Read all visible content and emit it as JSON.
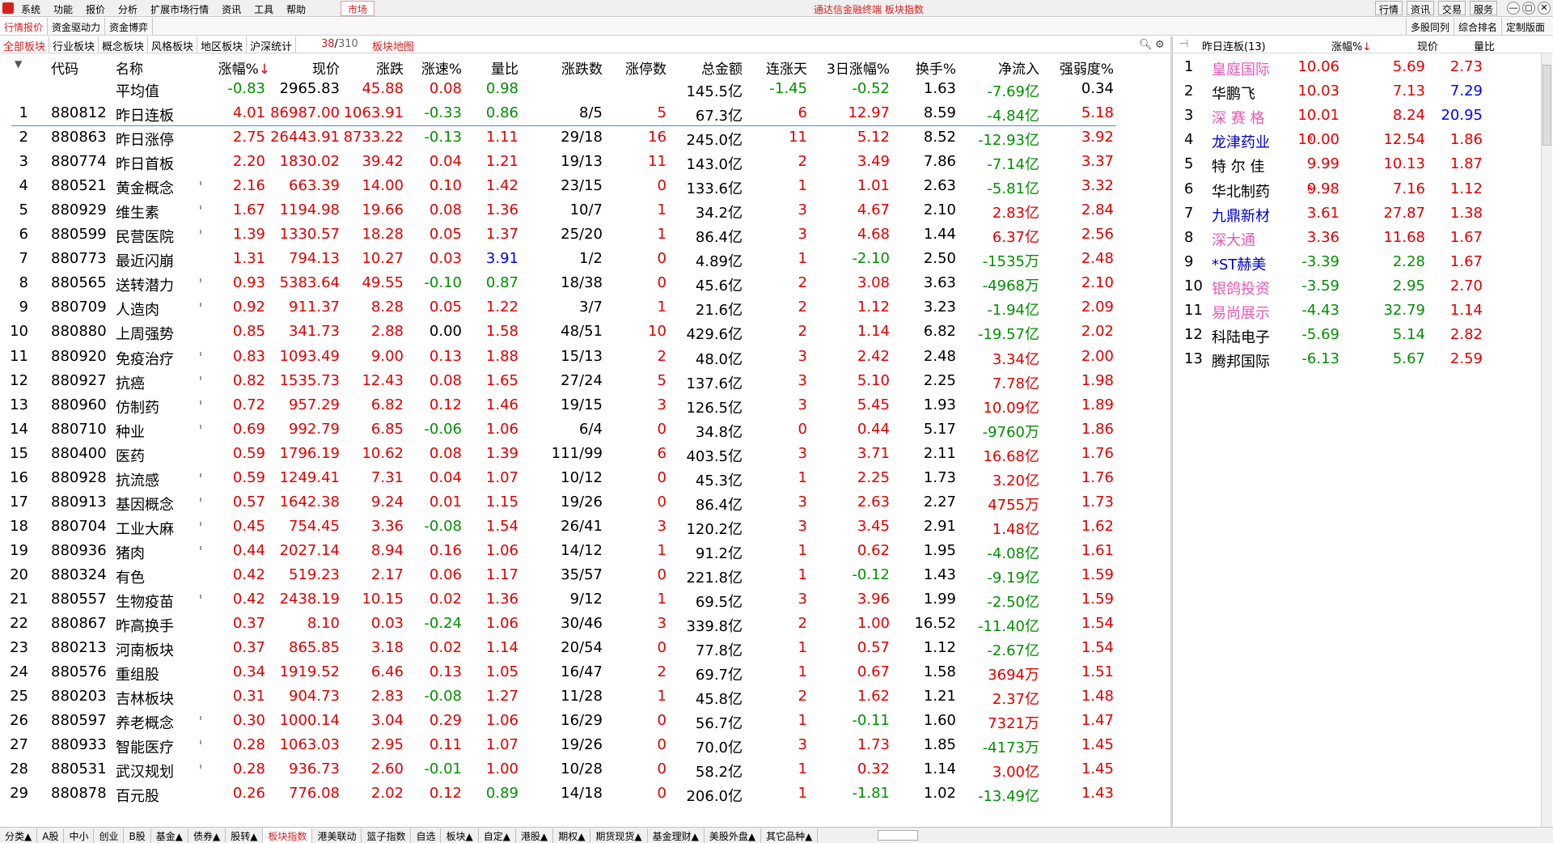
{
  "menubar": {
    "items": [
      "系统",
      "功能",
      "报价",
      "分析",
      "扩展市场行情",
      "资讯",
      "工具",
      "帮助"
    ],
    "market_label": "市场",
    "title": "通达信金融终端  板块指数",
    "right_buttons": [
      "行情",
      "资讯",
      "交易",
      "服务"
    ],
    "window_buttons": [
      "—",
      "◻",
      "✕"
    ]
  },
  "bar2": {
    "tabs": [
      "行情报价",
      "资金驱动力",
      "资金博弈"
    ],
    "right_tabs": [
      "多股同列",
      "综合排名",
      "定制版面"
    ]
  },
  "bar3": {
    "tabs": [
      "全部板块",
      "行业板块",
      "概念板块",
      "风格板块",
      "地区板块",
      "沪深统计"
    ],
    "pager_current": "38",
    "pager_sep": "/",
    "pager_total": "310",
    "map_label": "板块地图"
  },
  "table": {
    "headers": [
      "代码",
      "名称",
      "涨幅%",
      "现价",
      "涨跌",
      "涨速%",
      "量比",
      "涨跌数",
      "涨停数",
      "总金额",
      "连涨天",
      "3日涨幅%",
      "换手%",
      "净流入",
      "强弱度%"
    ],
    "sort_arrow": "↓",
    "average": {
      "label": "平均值",
      "change_pct": "-0.83",
      "price": "2965.83",
      "change": "45.88",
      "speed": "0.08",
      "vol_ratio": "0.98",
      "amount": "145.5亿",
      "up_days": "-1.45",
      "chg3": "-0.52",
      "turnover": "1.63",
      "net_inflow": "-7.69亿",
      "strength": "0.34"
    },
    "rows": [
      {
        "no": "1",
        "code": "880812",
        "name": "昨日连板",
        "pct": "4.01",
        "price": "86987.00",
        "chg": "1063.91",
        "spd": "-0.33",
        "vr": "0.86",
        "ud": "8/5",
        "lim": "5",
        "amt": "67.3亿",
        "days": "6",
        "c3": "12.97",
        "to": "8.59",
        "net": "-4.84亿",
        "str": "5.18",
        "tick": false
      },
      {
        "no": "2",
        "code": "880863",
        "name": "昨日涨停",
        "pct": "2.75",
        "price": "26443.91",
        "chg": "8733.22",
        "spd": "-0.13",
        "vr": "1.11",
        "ud": "29/18",
        "lim": "16",
        "amt": "245.0亿",
        "days": "11",
        "c3": "5.12",
        "to": "8.52",
        "net": "-12.93亿",
        "str": "3.92",
        "tick": false
      },
      {
        "no": "3",
        "code": "880774",
        "name": "昨日首板",
        "pct": "2.20",
        "price": "1830.02",
        "chg": "39.42",
        "spd": "0.04",
        "vr": "1.21",
        "ud": "19/13",
        "lim": "11",
        "amt": "143.0亿",
        "days": "2",
        "c3": "3.49",
        "to": "7.86",
        "net": "-7.14亿",
        "str": "3.37",
        "tick": false
      },
      {
        "no": "4",
        "code": "880521",
        "name": "黄金概念",
        "pct": "2.16",
        "price": "663.39",
        "chg": "14.00",
        "spd": "0.10",
        "vr": "1.42",
        "ud": "23/15",
        "lim": "0",
        "amt": "133.6亿",
        "days": "1",
        "c3": "1.01",
        "to": "2.63",
        "net": "-5.81亿",
        "str": "3.32",
        "tick": true
      },
      {
        "no": "5",
        "code": "880929",
        "name": "维生素",
        "pct": "1.67",
        "price": "1194.98",
        "chg": "19.66",
        "spd": "0.08",
        "vr": "1.36",
        "ud": "10/7",
        "lim": "1",
        "amt": "34.2亿",
        "days": "3",
        "c3": "4.67",
        "to": "2.10",
        "net": "2.83亿",
        "str": "2.84",
        "tick": true
      },
      {
        "no": "6",
        "code": "880599",
        "name": "民营医院",
        "pct": "1.39",
        "price": "1330.57",
        "chg": "18.28",
        "spd": "0.05",
        "vr": "1.37",
        "ud": "25/20",
        "lim": "1",
        "amt": "86.4亿",
        "days": "3",
        "c3": "4.68",
        "to": "1.44",
        "net": "6.37亿",
        "str": "2.56",
        "tick": true
      },
      {
        "no": "7",
        "code": "880773",
        "name": "最近闪崩",
        "pct": "1.31",
        "price": "794.13",
        "chg": "10.27",
        "spd": "0.03",
        "vr": "3.91",
        "ud": "1/2",
        "lim": "0",
        "amt": "4.89亿",
        "days": "1",
        "c3": "-2.10",
        "to": "2.50",
        "net": "-1535万",
        "str": "2.48",
        "tick": false
      },
      {
        "no": "8",
        "code": "880565",
        "name": "送转潜力",
        "pct": "0.93",
        "price": "5383.64",
        "chg": "49.55",
        "spd": "-0.10",
        "vr": "0.87",
        "ud": "18/38",
        "lim": "0",
        "amt": "45.6亿",
        "days": "2",
        "c3": "3.08",
        "to": "3.63",
        "net": "-4968万",
        "str": "2.10",
        "tick": true
      },
      {
        "no": "9",
        "code": "880709",
        "name": "人造肉",
        "pct": "0.92",
        "price": "911.37",
        "chg": "8.28",
        "spd": "0.05",
        "vr": "1.22",
        "ud": "3/7",
        "lim": "1",
        "amt": "21.6亿",
        "days": "2",
        "c3": "1.12",
        "to": "3.23",
        "net": "-1.94亿",
        "str": "2.09",
        "tick": true
      },
      {
        "no": "10",
        "code": "880880",
        "name": "上周强势",
        "pct": "0.85",
        "price": "341.73",
        "chg": "2.88",
        "spd": "0.00",
        "vr": "1.58",
        "ud": "48/51",
        "lim": "10",
        "amt": "429.6亿",
        "days": "2",
        "c3": "1.14",
        "to": "6.82",
        "net": "-19.57亿",
        "str": "2.02",
        "tick": false
      },
      {
        "no": "11",
        "code": "880920",
        "name": "免疫治疗",
        "pct": "0.83",
        "price": "1093.49",
        "chg": "9.00",
        "spd": "0.13",
        "vr": "1.88",
        "ud": "15/13",
        "lim": "2",
        "amt": "48.0亿",
        "days": "3",
        "c3": "2.42",
        "to": "2.48",
        "net": "3.34亿",
        "str": "2.00",
        "tick": true
      },
      {
        "no": "12",
        "code": "880927",
        "name": "抗癌",
        "pct": "0.82",
        "price": "1535.73",
        "chg": "12.43",
        "spd": "0.08",
        "vr": "1.65",
        "ud": "27/24",
        "lim": "5",
        "amt": "137.6亿",
        "days": "3",
        "c3": "5.10",
        "to": "2.25",
        "net": "7.78亿",
        "str": "1.98",
        "tick": true
      },
      {
        "no": "13",
        "code": "880960",
        "name": "仿制药",
        "pct": "0.72",
        "price": "957.29",
        "chg": "6.82",
        "spd": "0.12",
        "vr": "1.46",
        "ud": "19/15",
        "lim": "3",
        "amt": "126.5亿",
        "days": "3",
        "c3": "5.45",
        "to": "1.93",
        "net": "10.09亿",
        "str": "1.89",
        "tick": true
      },
      {
        "no": "14",
        "code": "880710",
        "name": "种业",
        "pct": "0.69",
        "price": "992.79",
        "chg": "6.85",
        "spd": "-0.06",
        "vr": "1.06",
        "ud": "6/4",
        "lim": "0",
        "amt": "34.8亿",
        "days": "0",
        "c3": "0.44",
        "to": "5.17",
        "net": "-9760万",
        "str": "1.86",
        "tick": true
      },
      {
        "no": "15",
        "code": "880400",
        "name": "医药",
        "pct": "0.59",
        "price": "1796.19",
        "chg": "10.62",
        "spd": "0.08",
        "vr": "1.39",
        "ud": "111/99",
        "lim": "6",
        "amt": "403.5亿",
        "days": "3",
        "c3": "3.71",
        "to": "2.11",
        "net": "16.68亿",
        "str": "1.76",
        "tick": false
      },
      {
        "no": "16",
        "code": "880928",
        "name": "抗流感",
        "pct": "0.59",
        "price": "1249.41",
        "chg": "7.31",
        "spd": "0.04",
        "vr": "1.07",
        "ud": "10/12",
        "lim": "0",
        "amt": "45.3亿",
        "days": "1",
        "c3": "2.25",
        "to": "1.73",
        "net": "3.20亿",
        "str": "1.76",
        "tick": true
      },
      {
        "no": "17",
        "code": "880913",
        "name": "基因概念",
        "pct": "0.57",
        "price": "1642.38",
        "chg": "9.24",
        "spd": "0.01",
        "vr": "1.15",
        "ud": "19/26",
        "lim": "0",
        "amt": "86.4亿",
        "days": "3",
        "c3": "2.63",
        "to": "2.27",
        "net": "4755万",
        "str": "1.73",
        "tick": true
      },
      {
        "no": "18",
        "code": "880704",
        "name": "工业大麻",
        "pct": "0.45",
        "price": "754.45",
        "chg": "3.36",
        "spd": "-0.08",
        "vr": "1.54",
        "ud": "26/41",
        "lim": "3",
        "amt": "120.2亿",
        "days": "3",
        "c3": "3.45",
        "to": "2.91",
        "net": "1.48亿",
        "str": "1.62",
        "tick": true
      },
      {
        "no": "19",
        "code": "880936",
        "name": "猪肉",
        "pct": "0.44",
        "price": "2027.14",
        "chg": "8.94",
        "spd": "0.16",
        "vr": "1.06",
        "ud": "14/12",
        "lim": "1",
        "amt": "91.2亿",
        "days": "1",
        "c3": "0.62",
        "to": "1.95",
        "net": "-4.08亿",
        "str": "1.61",
        "tick": true
      },
      {
        "no": "20",
        "code": "880324",
        "name": "有色",
        "pct": "0.42",
        "price": "519.23",
        "chg": "2.17",
        "spd": "0.06",
        "vr": "1.17",
        "ud": "35/57",
        "lim": "0",
        "amt": "221.8亿",
        "days": "1",
        "c3": "-0.12",
        "to": "1.43",
        "net": "-9.19亿",
        "str": "1.59",
        "tick": false
      },
      {
        "no": "21",
        "code": "880557",
        "name": "生物疫苗",
        "pct": "0.42",
        "price": "2438.19",
        "chg": "10.15",
        "spd": "0.02",
        "vr": "1.36",
        "ud": "9/12",
        "lim": "1",
        "amt": "69.5亿",
        "days": "3",
        "c3": "3.96",
        "to": "1.99",
        "net": "-2.50亿",
        "str": "1.59",
        "tick": true
      },
      {
        "no": "22",
        "code": "880867",
        "name": "昨高换手",
        "pct": "0.37",
        "price": "8.10",
        "chg": "0.03",
        "spd": "-0.24",
        "vr": "1.06",
        "ud": "30/46",
        "lim": "3",
        "amt": "339.8亿",
        "days": "2",
        "c3": "1.00",
        "to": "16.52",
        "net": "-11.40亿",
        "str": "1.54",
        "tick": false
      },
      {
        "no": "23",
        "code": "880213",
        "name": "河南板块",
        "pct": "0.37",
        "price": "865.85",
        "chg": "3.18",
        "spd": "0.02",
        "vr": "1.14",
        "ud": "20/54",
        "lim": "0",
        "amt": "77.8亿",
        "days": "1",
        "c3": "0.57",
        "to": "1.12",
        "net": "-2.67亿",
        "str": "1.54",
        "tick": false
      },
      {
        "no": "24",
        "code": "880576",
        "name": "重组股",
        "pct": "0.34",
        "price": "1919.52",
        "chg": "6.46",
        "spd": "0.13",
        "vr": "1.05",
        "ud": "16/47",
        "lim": "2",
        "amt": "69.7亿",
        "days": "1",
        "c3": "0.67",
        "to": "1.58",
        "net": "3694万",
        "str": "1.51",
        "tick": false
      },
      {
        "no": "25",
        "code": "880203",
        "name": "吉林板块",
        "pct": "0.31",
        "price": "904.73",
        "chg": "2.83",
        "spd": "-0.08",
        "vr": "1.27",
        "ud": "11/28",
        "lim": "1",
        "amt": "45.8亿",
        "days": "2",
        "c3": "1.62",
        "to": "1.21",
        "net": "2.37亿",
        "str": "1.48",
        "tick": false
      },
      {
        "no": "26",
        "code": "880597",
        "name": "养老概念",
        "pct": "0.30",
        "price": "1000.14",
        "chg": "3.04",
        "spd": "0.29",
        "vr": "1.06",
        "ud": "16/29",
        "lim": "0",
        "amt": "56.7亿",
        "days": "1",
        "c3": "-0.11",
        "to": "1.60",
        "net": "7321万",
        "str": "1.47",
        "tick": true
      },
      {
        "no": "27",
        "code": "880933",
        "name": "智能医疗",
        "pct": "0.28",
        "price": "1063.03",
        "chg": "2.95",
        "spd": "0.11",
        "vr": "1.07",
        "ud": "19/26",
        "lim": "0",
        "amt": "70.0亿",
        "days": "3",
        "c3": "1.73",
        "to": "1.85",
        "net": "-4173万",
        "str": "1.45",
        "tick": true
      },
      {
        "no": "28",
        "code": "880531",
        "name": "武汉规划",
        "pct": "0.28",
        "price": "936.73",
        "chg": "2.60",
        "spd": "-0.01",
        "vr": "1.00",
        "ud": "10/28",
        "lim": "0",
        "amt": "58.2亿",
        "days": "1",
        "c3": "0.32",
        "to": "1.14",
        "net": "3.00亿",
        "str": "1.45",
        "tick": true
      },
      {
        "no": "29",
        "code": "880878",
        "name": "百元股",
        "pct": "0.26",
        "price": "776.08",
        "chg": "2.02",
        "spd": "0.12",
        "vr": "0.89",
        "ud": "14/18",
        "lim": "0",
        "amt": "206.0亿",
        "days": "1",
        "c3": "-1.81",
        "to": "1.02",
        "net": "-13.49亿",
        "str": "1.43",
        "tick": false
      }
    ]
  },
  "right_panel": {
    "pin_icon": "⊣",
    "title": "昨日连板(13)",
    "col_pct": "涨幅%",
    "col_price": "现价",
    "col_vr": "量比",
    "sort_arrow": "↓",
    "rows": [
      {
        "no": "1",
        "name": "皇庭国际",
        "tag": "",
        "pct": "10.06",
        "price": "5.69",
        "vr": "2.73",
        "color": "#e85ab4",
        "vrblue": false
      },
      {
        "no": "2",
        "name": "华鹏飞",
        "tag": "",
        "pct": "10.03",
        "price": "7.13",
        "vr": "7.29",
        "color": "#000000",
        "vrblue": true
      },
      {
        "no": "3",
        "name": "深 赛 格",
        "tag": "",
        "pct": "10.01",
        "price": "8.24",
        "vr": "20.95",
        "color": "#e85ab4",
        "vrblue": true
      },
      {
        "no": "4",
        "name": "龙津药业",
        "tag": "R",
        "pct": "10.00",
        "price": "12.54",
        "vr": "1.86",
        "color": "#0000cc",
        "vrblue": false
      },
      {
        "no": "5",
        "name": "特 尔 佳",
        "tag": "",
        "pct": "9.99",
        "price": "10.13",
        "vr": "1.87",
        "color": "#000000",
        "vrblue": false
      },
      {
        "no": "6",
        "name": "华北制药",
        "tag": "R",
        "pct": "9.98",
        "price": "7.16",
        "vr": "1.12",
        "color": "#000000",
        "vrblue": false
      },
      {
        "no": "7",
        "name": "九鼎新材",
        "tag": "",
        "pct": "3.61",
        "price": "27.87",
        "vr": "1.38",
        "color": "#0000cc",
        "vrblue": false
      },
      {
        "no": "8",
        "name": "深大通",
        "tag": "",
        "pct": "3.36",
        "price": "11.68",
        "vr": "1.67",
        "color": "#e85ab4",
        "vrblue": false
      },
      {
        "no": "9",
        "name": "*ST赫美",
        "tag": "",
        "pct": "-3.39",
        "price": "2.28",
        "vr": "1.67",
        "color": "#0000cc",
        "vrblue": false
      },
      {
        "no": "10",
        "name": "银鸽投资",
        "tag": "",
        "pct": "-3.59",
        "price": "2.95",
        "vr": "2.70",
        "color": "#e85ab4",
        "vrblue": false
      },
      {
        "no": "11",
        "name": "易尚展示",
        "tag": "",
        "pct": "-4.43",
        "price": "32.79",
        "vr": "1.14",
        "color": "#e85ab4",
        "vrblue": false
      },
      {
        "no": "12",
        "name": "科陆电子",
        "tag": "",
        "pct": "-5.69",
        "price": "5.14",
        "vr": "2.82",
        "color": "#000000",
        "vrblue": false
      },
      {
        "no": "13",
        "name": "腾邦国际",
        "tag": "",
        "pct": "-6.13",
        "price": "5.67",
        "vr": "2.59",
        "color": "#000000",
        "vrblue": false
      }
    ]
  },
  "bottom_tabs": [
    "分类▲",
    "A股",
    "中小",
    "创业",
    "B股",
    "基金▲",
    "债券▲",
    "股转▲",
    "板块指数",
    "港美联动",
    "篮子指数",
    "自选",
    "板块▲",
    "自定▲",
    "港股▲",
    "期权▲",
    "期货现货▲",
    "基金理财▲",
    "美股外盘▲",
    "其它品种▲"
  ],
  "bottom_active": "板块指数",
  "colors": {
    "up": "#e00000",
    "down": "#009000",
    "accent": "#d81e1e"
  }
}
